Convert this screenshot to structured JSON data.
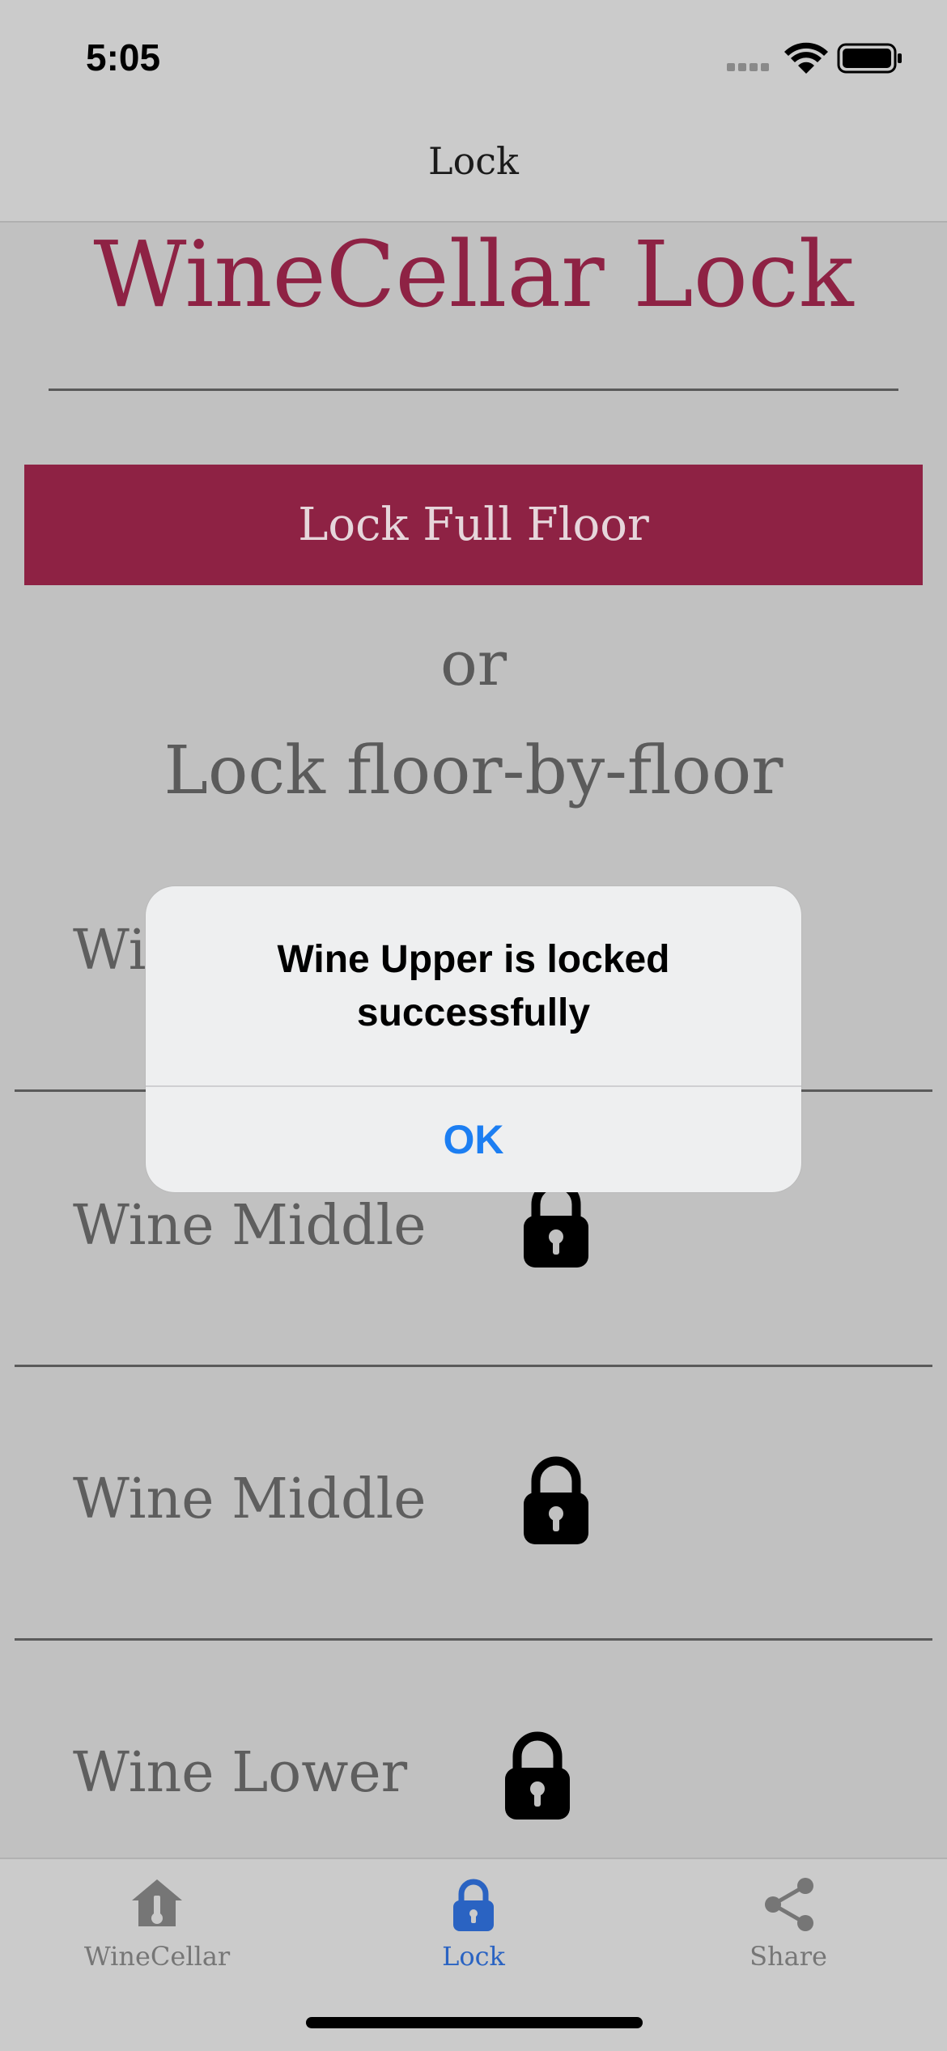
{
  "status_bar": {
    "time": "5:05"
  },
  "nav": {
    "title": "Lock"
  },
  "app": {
    "title": "WineCellar Lock"
  },
  "actions": {
    "lock_all_label": "Lock Full Floor"
  },
  "text": {
    "or": "or",
    "subheading": "Lock floor-by-floor"
  },
  "floors": [
    {
      "label": "Wine Upper",
      "icon": "lock-icon"
    },
    {
      "label": "Wine Middle",
      "icon": "lock-icon"
    },
    {
      "label": "Wine Middle",
      "icon": "lock-icon"
    },
    {
      "label": "Wine Lower",
      "icon": "lock-icon"
    }
  ],
  "alert": {
    "message": "Wine Upper is locked successfully",
    "ok_label": "OK"
  },
  "tabs": [
    {
      "label": "WineCellar",
      "icon": "winecellar-icon",
      "active": false
    },
    {
      "label": "Lock",
      "icon": "lock-icon",
      "active": true
    },
    {
      "label": "Share",
      "icon": "share-icon",
      "active": false
    }
  ],
  "colors": {
    "accent": "#8e2244",
    "tab_active": "#2a63c2",
    "alert_button": "#1c7ef2"
  }
}
